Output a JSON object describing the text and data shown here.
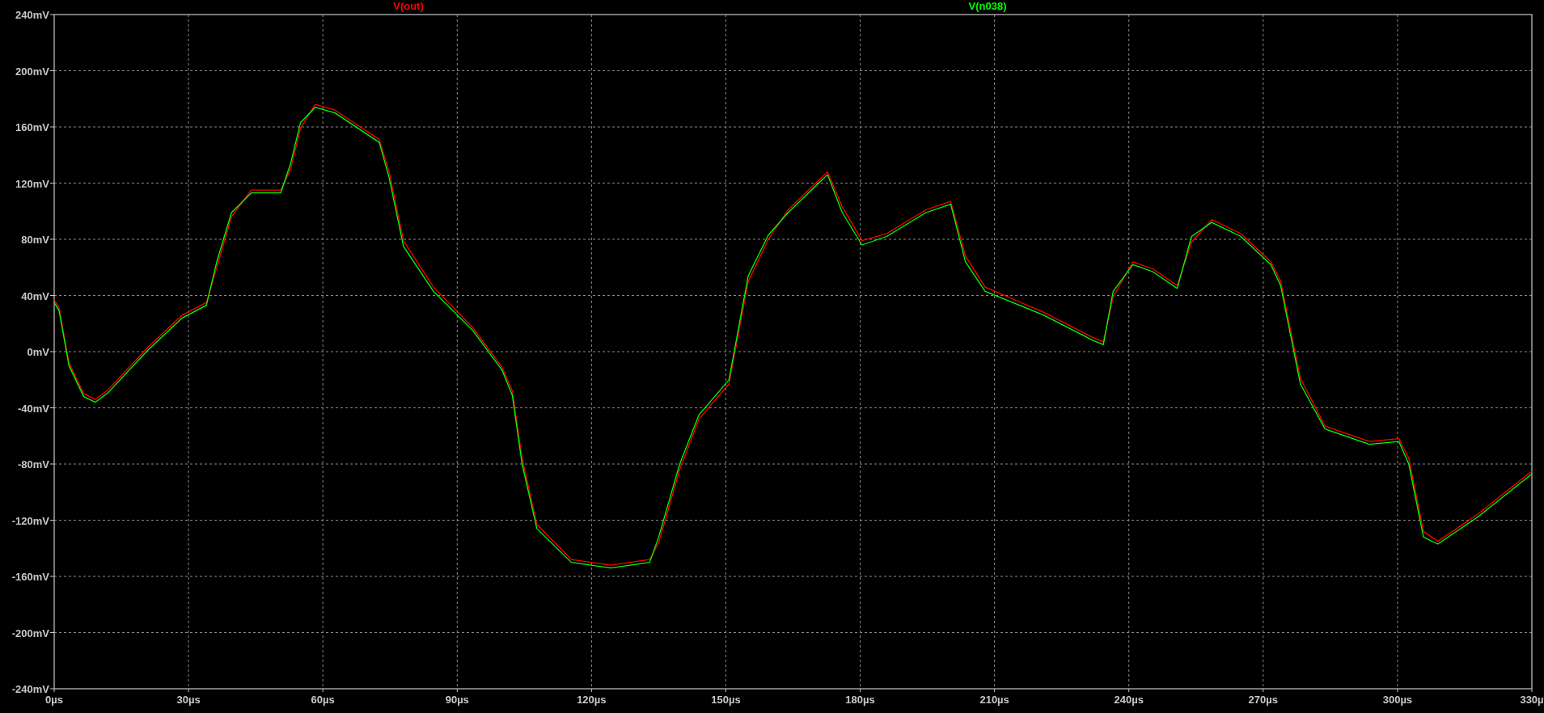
{
  "plot": {
    "chart_data": {
      "type": "line",
      "grid": true,
      "xlim": [
        0,
        330
      ],
      "ylim": [
        -240,
        240
      ],
      "x": [
        0,
        1.1,
        3.3,
        6.6,
        9.2,
        12.1,
        20.9,
        28.6,
        34,
        36.3,
        39.6,
        44,
        50.6,
        52.8,
        55,
        58.3,
        62.7,
        72.6,
        74.8,
        78,
        84.7,
        93.5,
        100,
        102.3,
        104.5,
        107.8,
        115.5,
        124.3,
        133,
        135,
        139.7,
        144,
        150.7,
        155,
        159.5,
        163.9,
        172.7,
        176,
        180.4,
        185.9,
        194.7,
        200.2,
        203.5,
        207.9,
        221,
        232,
        234.3,
        236.5,
        240.9,
        245.3,
        250.8,
        254,
        258.5,
        265,
        271.7,
        273.9,
        278.3,
        283.8,
        293.7,
        300.3,
        302.5,
        305.8,
        309,
        317.8,
        330
      ],
      "series": [
        {
          "name": "V(out)",
          "color": "#ff0000",
          "values": [
            37,
            31,
            -8,
            -30,
            -34,
            -27,
            3,
            26,
            35,
            60,
            96,
            115,
            115,
            130,
            159,
            176,
            172,
            151,
            128,
            79,
            46,
            17,
            -11,
            -28,
            -76,
            -123,
            -148,
            -152,
            -148,
            -136,
            -84,
            -48,
            -23,
            50,
            80,
            101,
            128,
            103,
            79,
            84,
            101,
            107,
            68,
            46,
            28,
            10,
            7,
            39,
            64,
            59,
            47,
            78,
            94,
            84,
            64,
            50,
            -19,
            -53,
            -64,
            -62,
            -76,
            -128,
            -135,
            -116,
            -85
          ]
        },
        {
          "name": "V(n038)",
          "color": "#00ff00",
          "values": [
            35,
            29,
            -10,
            -32,
            -36,
            -29,
            1,
            24,
            33,
            64,
            99,
            113,
            113,
            134,
            163,
            174,
            170,
            149,
            124,
            75,
            43,
            15,
            -13,
            -31,
            -80,
            -126,
            -150,
            -154,
            -150,
            -132,
            -80,
            -45,
            -20,
            54,
            83,
            99,
            126,
            99,
            76,
            82,
            99,
            105,
            64,
            43,
            26,
            8,
            5,
            43,
            62,
            57,
            45,
            82,
            92,
            82,
            62,
            47,
            -23,
            -55,
            -66,
            -64,
            -80,
            -132,
            -137,
            -118,
            -87
          ]
        }
      ],
      "xticks": [
        {
          "value": 0,
          "label": "0µs"
        },
        {
          "value": 30,
          "label": "30µs"
        },
        {
          "value": 60,
          "label": "60µs"
        },
        {
          "value": 90,
          "label": "90µs"
        },
        {
          "value": 120,
          "label": "120µs"
        },
        {
          "value": 150,
          "label": "150µs"
        },
        {
          "value": 180,
          "label": "180µs"
        },
        {
          "value": 210,
          "label": "210µs"
        },
        {
          "value": 240,
          "label": "240µs"
        },
        {
          "value": 270,
          "label": "270µs"
        },
        {
          "value": 300,
          "label": "300µs"
        },
        {
          "value": 330,
          "label": "330µ"
        }
      ],
      "yticks": [
        {
          "value": 240,
          "label": "240mV"
        },
        {
          "value": 200,
          "label": "200mV"
        },
        {
          "value": 160,
          "label": "160mV"
        },
        {
          "value": 120,
          "label": "120mV"
        },
        {
          "value": 80,
          "label": "80mV"
        },
        {
          "value": 40,
          "label": "40mV"
        },
        {
          "value": 0,
          "label": "0mV"
        },
        {
          "value": -40,
          "label": "-40mV"
        },
        {
          "value": -80,
          "label": "-80mV"
        },
        {
          "value": -120,
          "label": "-120mV"
        },
        {
          "value": -160,
          "label": "-160mV"
        },
        {
          "value": -200,
          "label": "-200mV"
        },
        {
          "value": -240,
          "label": "-240mV"
        }
      ]
    }
  }
}
